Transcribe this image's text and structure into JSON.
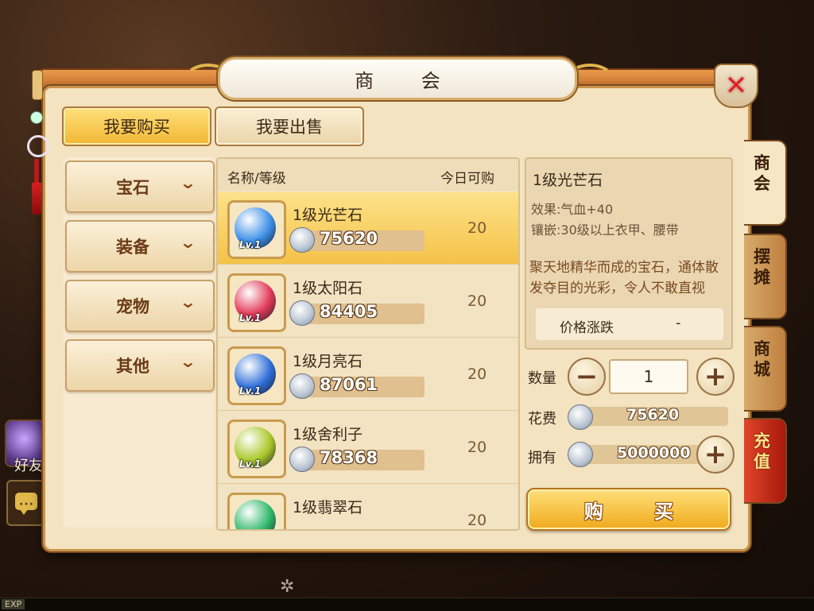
{
  "window": {
    "title": "商 会"
  },
  "tabs": {
    "buy": "我要购买",
    "sell": "我要出售"
  },
  "categories": [
    {
      "label": "宝石"
    },
    {
      "label": "装备"
    },
    {
      "label": "宠物"
    },
    {
      "label": "其他"
    }
  ],
  "list": {
    "header_name": "名称/等级",
    "header_limit": "今日可购",
    "items": [
      {
        "name": "1级光芒石",
        "price": "75620",
        "limit": "20",
        "level": "Lv.1",
        "gem_color": "#3c8fe8"
      },
      {
        "name": "1级太阳石",
        "price": "84405",
        "limit": "20",
        "level": "Lv.1",
        "gem_color": "#e23a58"
      },
      {
        "name": "1级月亮石",
        "price": "87061",
        "limit": "20",
        "level": "Lv.1",
        "gem_color": "#2f6fd8"
      },
      {
        "name": "1级舍利子",
        "price": "78368",
        "limit": "20",
        "level": "Lv.1",
        "gem_color": "#a9c82a"
      },
      {
        "name": "1级翡翠石",
        "price": "",
        "limit": "20",
        "level": "",
        "gem_color": "#2fb86a"
      }
    ]
  },
  "detail": {
    "title": "1级光芒石",
    "effect": "效果:气血+40",
    "inlay": "镶嵌:30级以上衣甲、腰带",
    "description": "聚天地精华而成的宝石，通体散发夺目的光彩，令人不敢直视",
    "trend_label": "价格涨跌",
    "trend_value": "-"
  },
  "purchase": {
    "qty_label": "数量",
    "qty_value": "1",
    "cost_label": "花费",
    "cost_value": "75620",
    "own_label": "拥有",
    "own_value": "5000000",
    "buy_label": "购 买"
  },
  "side_tabs": [
    {
      "label": "商会"
    },
    {
      "label": "摆摊"
    },
    {
      "label": "商城"
    },
    {
      "label": "充值"
    }
  ],
  "background": {
    "friend_label": "好友",
    "exp_label": "EXP"
  }
}
